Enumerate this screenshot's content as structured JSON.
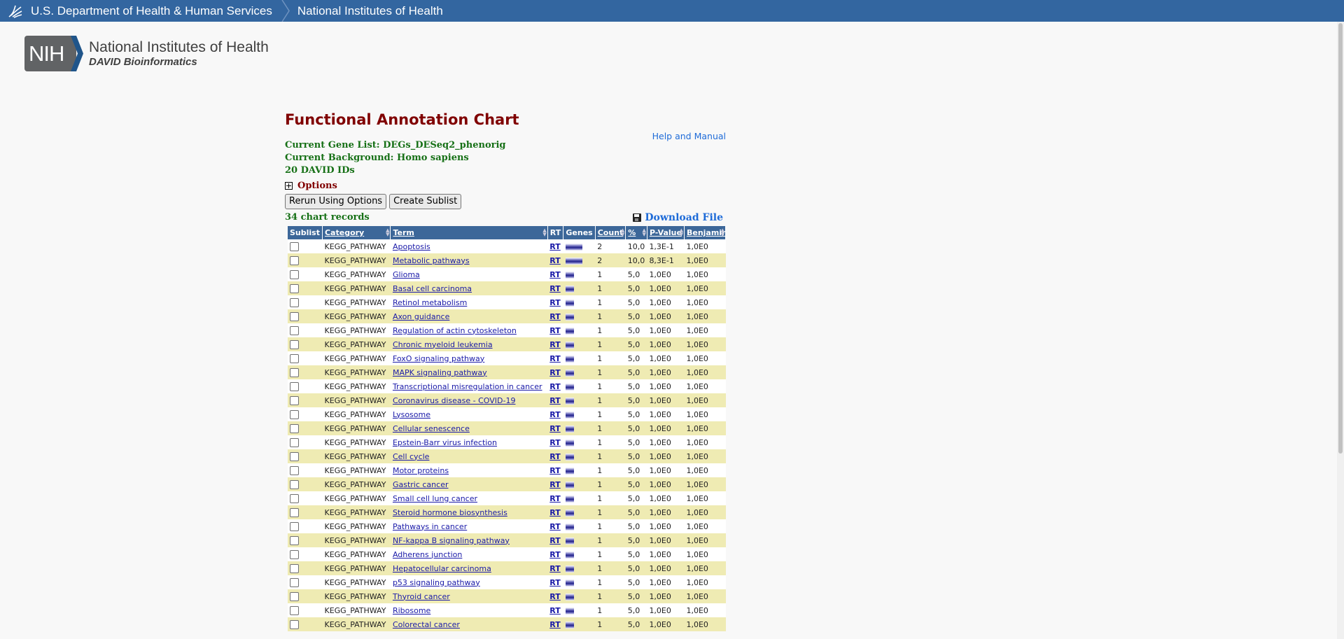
{
  "header": {
    "hhs_link": "U.S. Department of Health & Human Services",
    "nih_link": "National Institutes of Health"
  },
  "logo": {
    "badge": "NIH",
    "line1": "National Institutes of Health",
    "line2": "DAVID Bioinformatics"
  },
  "page": {
    "title": "Functional Annotation Chart",
    "help": "Help and Manual",
    "gene_list": "Current Gene List: DEGs_DESeq2_phenorig",
    "background": "Current Background: Homo sapiens",
    "ids": "20 DAVID IDs",
    "options": "Options",
    "rerun_button": "Rerun Using Options",
    "sublist_button": "Create Sublist",
    "records": "34 chart records",
    "download": "Download File"
  },
  "table": {
    "headers": [
      "Sublist",
      "Category",
      "Term",
      "RT",
      "Genes",
      "Count",
      "%",
      "P-Value",
      "Benjamini"
    ],
    "rt_label": "RT",
    "rows": [
      {
        "category": "KEGG_PATHWAY",
        "term": "Apoptosis",
        "count": "2",
        "percent": "10,0",
        "pvalue": "1,3E-1",
        "benjamini": "1,0E0",
        "checked": false
      },
      {
        "category": "KEGG_PATHWAY",
        "term": "Metabolic pathways",
        "count": "2",
        "percent": "10,0",
        "pvalue": "8,3E-1",
        "benjamini": "1,0E0",
        "checked": false
      },
      {
        "category": "KEGG_PATHWAY",
        "term": "Glioma",
        "count": "1",
        "percent": "5,0",
        "pvalue": "1,0E0",
        "benjamini": "1,0E0",
        "checked": false
      },
      {
        "category": "KEGG_PATHWAY",
        "term": "Basal cell carcinoma",
        "count": "1",
        "percent": "5,0",
        "pvalue": "1,0E0",
        "benjamini": "1,0E0",
        "checked": false
      },
      {
        "category": "KEGG_PATHWAY",
        "term": "Retinol metabolism",
        "count": "1",
        "percent": "5,0",
        "pvalue": "1,0E0",
        "benjamini": "1,0E0",
        "checked": false
      },
      {
        "category": "KEGG_PATHWAY",
        "term": "Axon guidance",
        "count": "1",
        "percent": "5,0",
        "pvalue": "1,0E0",
        "benjamini": "1,0E0",
        "checked": false
      },
      {
        "category": "KEGG_PATHWAY",
        "term": "Regulation of actin cytoskeleton",
        "count": "1",
        "percent": "5,0",
        "pvalue": "1,0E0",
        "benjamini": "1,0E0",
        "checked": false
      },
      {
        "category": "KEGG_PATHWAY",
        "term": "Chronic myeloid leukemia",
        "count": "1",
        "percent": "5,0",
        "pvalue": "1,0E0",
        "benjamini": "1,0E0",
        "checked": false
      },
      {
        "category": "KEGG_PATHWAY",
        "term": "FoxO signaling pathway",
        "count": "1",
        "percent": "5,0",
        "pvalue": "1,0E0",
        "benjamini": "1,0E0",
        "checked": false
      },
      {
        "category": "KEGG_PATHWAY",
        "term": "MAPK signaling pathway",
        "count": "1",
        "percent": "5,0",
        "pvalue": "1,0E0",
        "benjamini": "1,0E0",
        "checked": false
      },
      {
        "category": "KEGG_PATHWAY",
        "term": "Transcriptional misregulation in cancer",
        "count": "1",
        "percent": "5,0",
        "pvalue": "1,0E0",
        "benjamini": "1,0E0",
        "checked": false
      },
      {
        "category": "KEGG_PATHWAY",
        "term": "Coronavirus disease - COVID-19",
        "count": "1",
        "percent": "5,0",
        "pvalue": "1,0E0",
        "benjamini": "1,0E0",
        "checked": false
      },
      {
        "category": "KEGG_PATHWAY",
        "term": "Lysosome",
        "count": "1",
        "percent": "5,0",
        "pvalue": "1,0E0",
        "benjamini": "1,0E0",
        "checked": false
      },
      {
        "category": "KEGG_PATHWAY",
        "term": "Cellular senescence",
        "count": "1",
        "percent": "5,0",
        "pvalue": "1,0E0",
        "benjamini": "1,0E0",
        "checked": false
      },
      {
        "category": "KEGG_PATHWAY",
        "term": "Epstein-Barr virus infection",
        "count": "1",
        "percent": "5,0",
        "pvalue": "1,0E0",
        "benjamini": "1,0E0",
        "checked": false
      },
      {
        "category": "KEGG_PATHWAY",
        "term": "Cell cycle",
        "count": "1",
        "percent": "5,0",
        "pvalue": "1,0E0",
        "benjamini": "1,0E0",
        "checked": false
      },
      {
        "category": "KEGG_PATHWAY",
        "term": "Motor proteins",
        "count": "1",
        "percent": "5,0",
        "pvalue": "1,0E0",
        "benjamini": "1,0E0",
        "checked": false
      },
      {
        "category": "KEGG_PATHWAY",
        "term": "Gastric cancer",
        "count": "1",
        "percent": "5,0",
        "pvalue": "1,0E0",
        "benjamini": "1,0E0",
        "checked": false
      },
      {
        "category": "KEGG_PATHWAY",
        "term": "Small cell lung cancer",
        "count": "1",
        "percent": "5,0",
        "pvalue": "1,0E0",
        "benjamini": "1,0E0",
        "checked": false
      },
      {
        "category": "KEGG_PATHWAY",
        "term": "Steroid hormone biosynthesis",
        "count": "1",
        "percent": "5,0",
        "pvalue": "1,0E0",
        "benjamini": "1,0E0",
        "checked": false
      },
      {
        "category": "KEGG_PATHWAY",
        "term": "Pathways in cancer",
        "count": "1",
        "percent": "5,0",
        "pvalue": "1,0E0",
        "benjamini": "1,0E0",
        "checked": false
      },
      {
        "category": "KEGG_PATHWAY",
        "term": "NF-kappa B signaling pathway",
        "count": "1",
        "percent": "5,0",
        "pvalue": "1,0E0",
        "benjamini": "1,0E0",
        "checked": false
      },
      {
        "category": "KEGG_PATHWAY",
        "term": "Adherens junction",
        "count": "1",
        "percent": "5,0",
        "pvalue": "1,0E0",
        "benjamini": "1,0E0",
        "checked": false
      },
      {
        "category": "KEGG_PATHWAY",
        "term": "Hepatocellular carcinoma",
        "count": "1",
        "percent": "5,0",
        "pvalue": "1,0E0",
        "benjamini": "1,0E0",
        "checked": false
      },
      {
        "category": "KEGG_PATHWAY",
        "term": "p53 signaling pathway",
        "count": "1",
        "percent": "5,0",
        "pvalue": "1,0E0",
        "benjamini": "1,0E0",
        "checked": false
      },
      {
        "category": "KEGG_PATHWAY",
        "term": "Thyroid cancer",
        "count": "1",
        "percent": "5,0",
        "pvalue": "1,0E0",
        "benjamini": "1,0E0",
        "checked": false
      },
      {
        "category": "KEGG_PATHWAY",
        "term": "Ribosome",
        "count": "1",
        "percent": "5,0",
        "pvalue": "1,0E0",
        "benjamini": "1,0E0",
        "checked": false
      },
      {
        "category": "KEGG_PATHWAY",
        "term": "Colorectal cancer",
        "count": "1",
        "percent": "5,0",
        "pvalue": "1,0E0",
        "benjamini": "1,0E0",
        "checked": false
      }
    ]
  },
  "colors": {
    "header_bar": "#3366a0",
    "title": "#800000",
    "info_green": "#167016",
    "table_header": "#3c6799",
    "row_highlight": "#efebb3",
    "link": "#1a1aa8"
  },
  "icons": [
    "hhs-eagle-icon",
    "breadcrumb-chevron-icon",
    "options-expand-icon",
    "floppy-disk-icon",
    "gene-bar-icon",
    "sort-arrows-icon"
  ]
}
